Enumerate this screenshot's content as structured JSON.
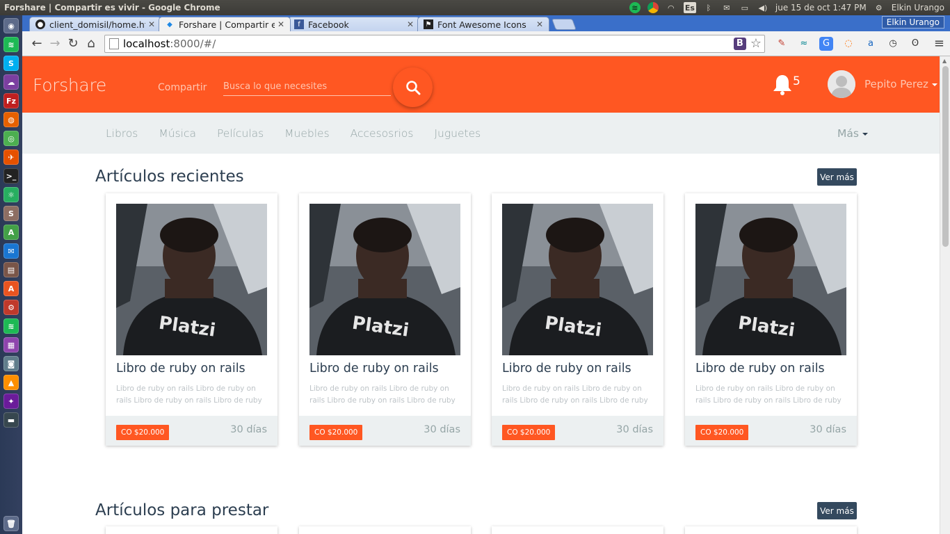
{
  "os": {
    "window_title": "Forshare | Compartir es vivir - Google Chrome",
    "keyboard": "Es",
    "clock": "jue 15 de oct  1:47 PM",
    "user": "Elkin Urango"
  },
  "browser": {
    "tabs": [
      {
        "title": "client_domisil/home.html",
        "favicon": "github-icon",
        "active": false
      },
      {
        "title": "Forshare | Compartir es vivir",
        "favicon": "angular-icon",
        "active": true
      },
      {
        "title": "Facebook",
        "favicon": "facebook-icon",
        "active": false
      },
      {
        "title": "Font Awesome Icons",
        "favicon": "flag-icon",
        "active": false
      }
    ],
    "profile": "Elkin Urango",
    "url_host": "localhost",
    "url_rest": ":8000/#/",
    "ext_b": "B"
  },
  "site": {
    "brand": "Forshare",
    "share_link": "Compartir",
    "search_placeholder": "Busca lo que necesites",
    "notifications": "5",
    "user_name": "Pepito Perez",
    "categories": [
      "Libros",
      "Música",
      "Películas",
      "Muebles",
      "Accesosrios",
      "Juguetes"
    ],
    "more": "Más",
    "colors": {
      "primary": "#ff5722",
      "dark": "#34495e",
      "nav_bg": "#ecf0f1"
    }
  },
  "sections": [
    {
      "title": "Artículos recientes",
      "button": "Ver más",
      "items": [
        {
          "title": "Libro de ruby on rails",
          "desc": "Libro de ruby on rails Libro de ruby on rails Libro de ruby on rails Libro de ruby",
          "price": "CO $20.000",
          "days": "30 días",
          "image_text": "Platzi"
        },
        {
          "title": "Libro de ruby on rails",
          "desc": "Libro de ruby on rails Libro de ruby on rails Libro de ruby on rails Libro de ruby",
          "price": "CO $20.000",
          "days": "30 días",
          "image_text": "Platzi"
        },
        {
          "title": "Libro de ruby on rails",
          "desc": "Libro de ruby on rails Libro de ruby on rails Libro de ruby on rails Libro de ruby",
          "price": "CO $20.000",
          "days": "30 días",
          "image_text": "Platzi"
        },
        {
          "title": "Libro de ruby on rails",
          "desc": "Libro de ruby on rails Libro de ruby on rails Libro de ruby on rails Libro de ruby",
          "price": "CO $20.000",
          "days": "30 días",
          "image_text": "Platzi"
        }
      ]
    },
    {
      "title": "Artículos para prestar",
      "button": "Ver más"
    }
  ]
}
